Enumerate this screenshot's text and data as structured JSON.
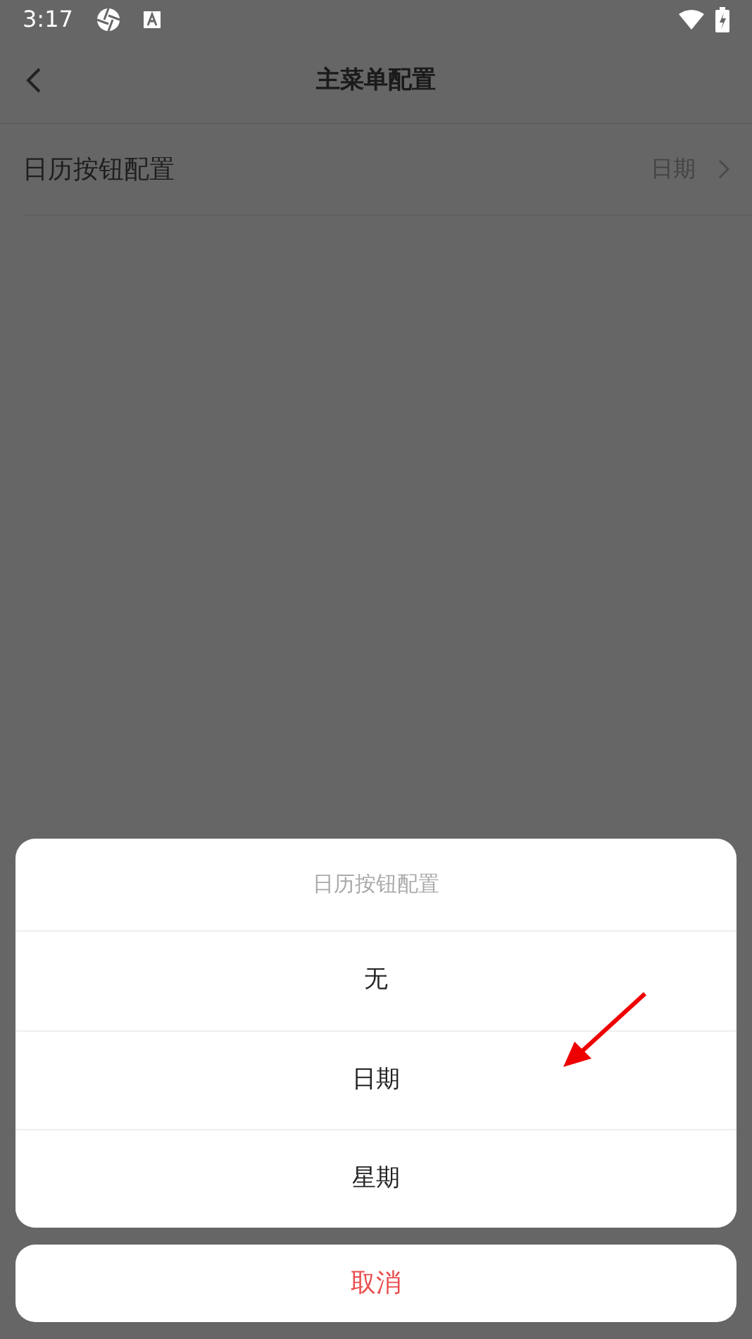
{
  "status_bar": {
    "time": "3:17"
  },
  "header": {
    "title": "主菜单配置"
  },
  "settings_rows": [
    {
      "label": "日历按钮配置",
      "value": "日期"
    }
  ],
  "action_sheet": {
    "title": "日历按钮配置",
    "options": [
      {
        "label": "无"
      },
      {
        "label": "日期"
      },
      {
        "label": "星期"
      }
    ],
    "cancel": "取消"
  }
}
